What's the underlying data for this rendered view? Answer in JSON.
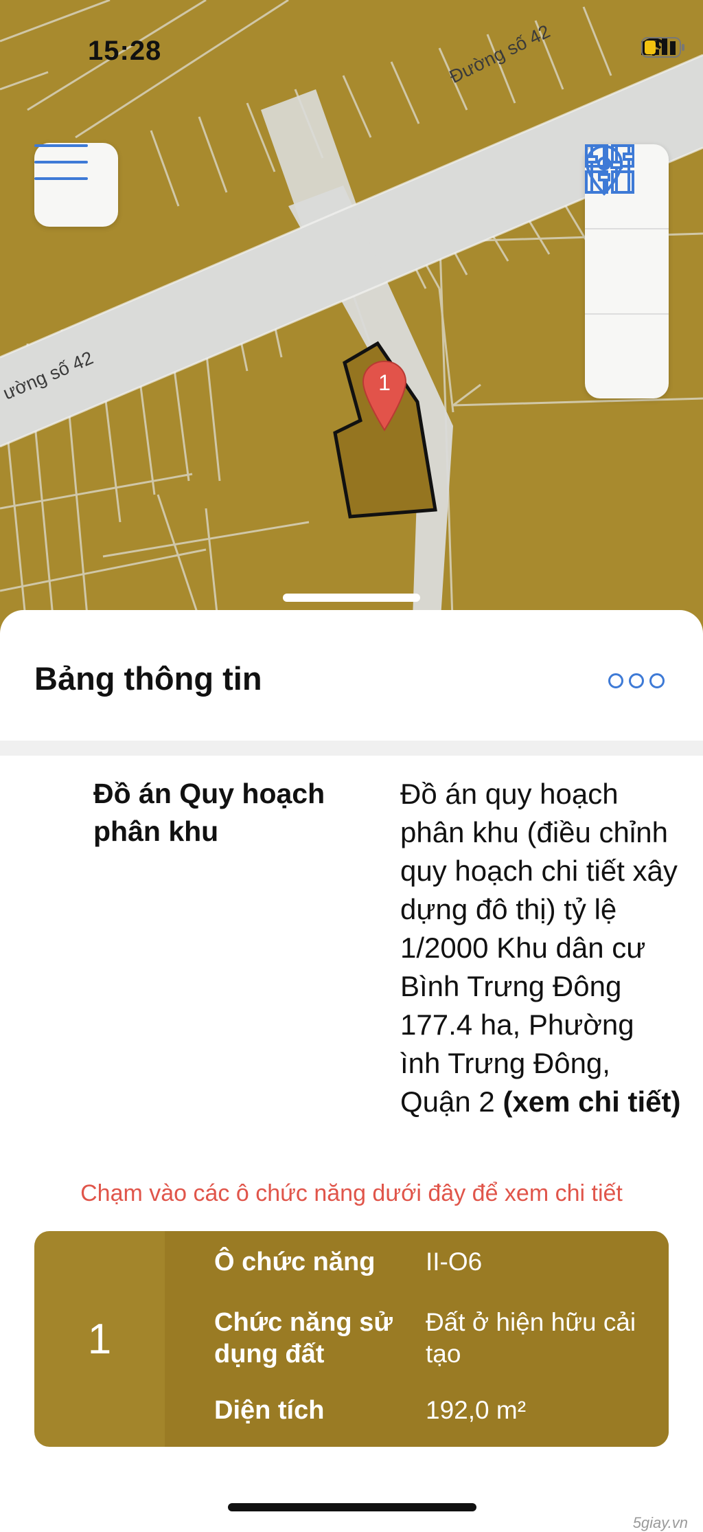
{
  "status": {
    "time": "15:28"
  },
  "map": {
    "road_label_top": "Đường số 42",
    "road_label_left": "ường số 42",
    "pin_label": "1"
  },
  "icons": {
    "menu": "hamburger-menu-icon",
    "layers": "grid-layers-icon",
    "location": "location-pin-icon",
    "filters": "sliders-icon",
    "more": "more-dots-icon"
  },
  "sheet": {
    "title": "Bảng thông tin",
    "plan_label": "Đồ án Quy hoạch phân khu",
    "plan_value": "Đồ án quy hoạch phân khu (điều chỉnh quy hoạch chi tiết xây dựng đô thị) tỷ lệ 1/2000 Khu dân cư Bình Trưng Đông 177.4 ha, Phường ình Trưng Đông, Quận 2",
    "plan_link": "(xem chi tiết)",
    "hint": "Chạm vào các ô chức năng dưới đây để xem chi tiết"
  },
  "zone": {
    "index": "1",
    "rows": [
      {
        "key": "Ô chức năng",
        "value": "II-O6"
      },
      {
        "key": "Chức năng sử dụng đất",
        "value": "Đất ở hiện hữu cải tạo"
      },
      {
        "key": "Diện tích",
        "value": "192,0 m²"
      }
    ]
  },
  "watermark": "5giay.vn",
  "colors": {
    "land": "#a88a2e",
    "road": "#dadbd9",
    "accent": "#3e7ad6",
    "hint": "#e0554a",
    "card": "#a3852b"
  }
}
